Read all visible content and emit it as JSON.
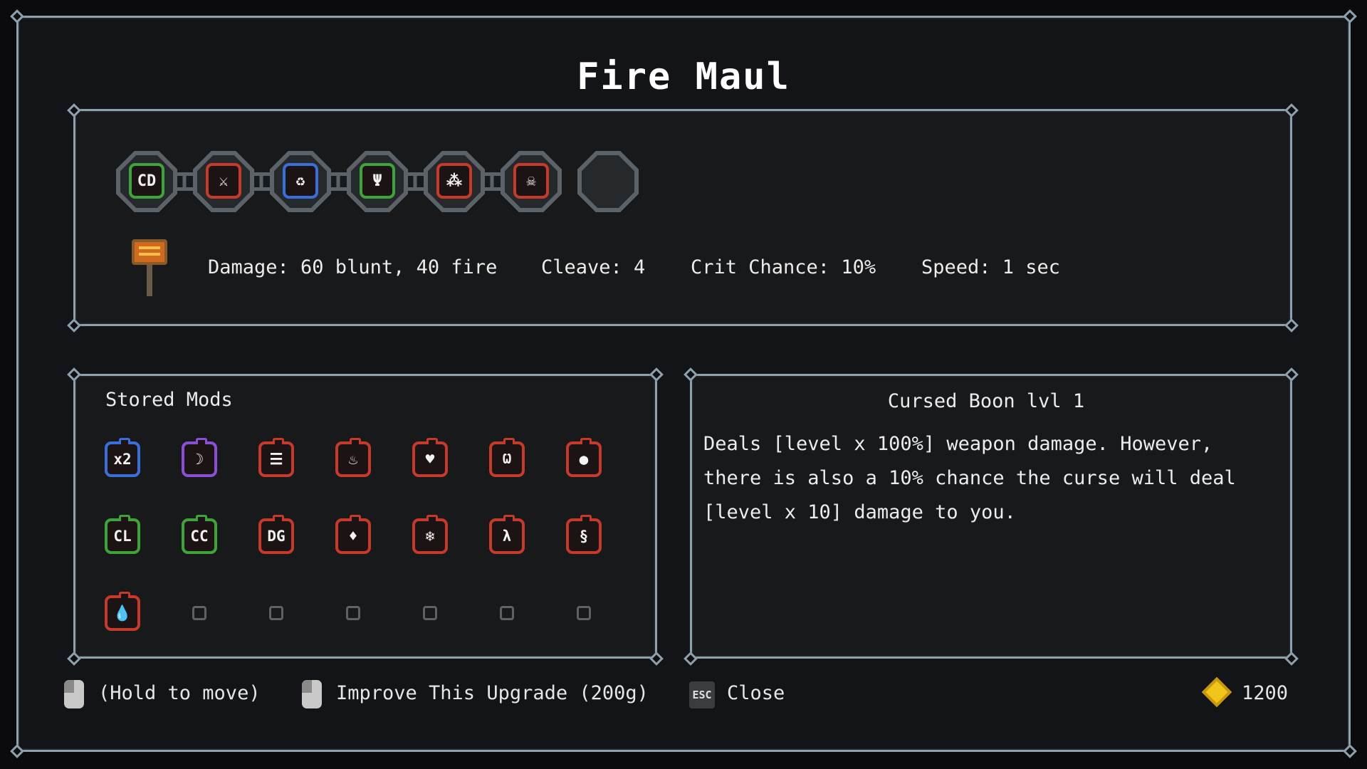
{
  "window": {
    "title": "Fire Maul"
  },
  "equipped_mods": [
    {
      "name": "cd-mod",
      "label": "CD",
      "color": "#3fa33a"
    },
    {
      "name": "slash-mod",
      "label": "⚔",
      "color": "#c53a2a"
    },
    {
      "name": "cycle-mod",
      "label": "♻",
      "color": "#3a6fd9"
    },
    {
      "name": "trident-mod",
      "label": "Ψ",
      "color": "#3fa33a"
    },
    {
      "name": "poison-mod",
      "label": "⁂",
      "color": "#c53a2a"
    },
    {
      "name": "skull-mod",
      "label": "☠",
      "color": "#c53a2a"
    }
  ],
  "empty_socket_count": 1,
  "weapon": {
    "icon": "fire-maul-icon",
    "damage": "Damage: 60 blunt, 40 fire",
    "cleave": "Cleave: 4",
    "crit": "Crit Chance: 10%",
    "speed": "Speed: 1 sec"
  },
  "stored_mods": {
    "title": "Stored Mods",
    "items": [
      {
        "name": "double-mod",
        "label": "x2",
        "color": "#3a6fd9"
      },
      {
        "name": "moon-mod",
        "label": "☽",
        "color": "#8a4fd6"
      },
      {
        "name": "list-mod",
        "label": "☰",
        "color": "#c53a2a"
      },
      {
        "name": "flames-mod",
        "label": "♨",
        "color": "#c53a2a"
      },
      {
        "name": "heart-mod",
        "label": "♥",
        "color": "#c53a2a"
      },
      {
        "name": "bite-mod",
        "label": "Ѡ",
        "color": "#c53a2a"
      },
      {
        "name": "bomb-mod",
        "label": "●",
        "color": "#c53a2a"
      },
      {
        "name": "cl-mod",
        "label": "CL",
        "color": "#3fa33a"
      },
      {
        "name": "cc-mod",
        "label": "CC",
        "color": "#3fa33a"
      },
      {
        "name": "dg-mod",
        "label": "DG",
        "color": "#c53a2a"
      },
      {
        "name": "fire-mod",
        "label": "♦",
        "color": "#c53a2a"
      },
      {
        "name": "ice-mod",
        "label": "❄",
        "color": "#c53a2a"
      },
      {
        "name": "runner-mod",
        "label": "λ",
        "color": "#c53a2a"
      },
      {
        "name": "swirl-mod",
        "label": "§",
        "color": "#c53a2a"
      },
      {
        "name": "water-mod",
        "label": "💧",
        "color": "#c53a2a"
      }
    ],
    "empty_slots": 6
  },
  "description": {
    "title": "Cursed Boon lvl 1",
    "text": "Deals [level x 100%] weapon damage. However, there is also a 10% chance the curse will deal [level x 10] damage to you."
  },
  "footer": {
    "hold_hint": "(Hold to move)",
    "improve_hint": "Improve This Upgrade (200g)",
    "esc_key": "ESC",
    "close_label": "Close",
    "gold": "1200"
  }
}
